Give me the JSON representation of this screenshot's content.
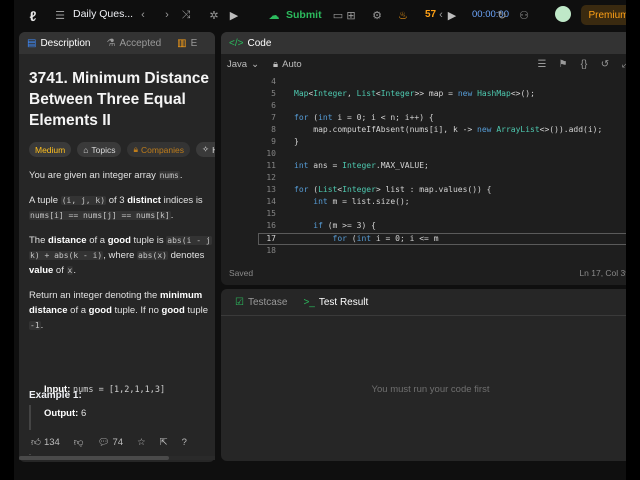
{
  "topnav": {
    "problem_list_label": "Daily Ques...",
    "submit_label": "Submit",
    "streak_count": "57",
    "timer": "00:00:00",
    "premium_label": "Premium"
  },
  "left": {
    "tabs": [
      {
        "label": "Description"
      },
      {
        "label": "Accepted"
      },
      {
        "label": "E"
      }
    ],
    "title": "3741. Minimum Distance\nBetween Three Equal\nElements II",
    "badges": {
      "difficulty": "Medium",
      "topics": "Topics",
      "companies": "Companies",
      "hint": "H"
    },
    "description": {
      "p1_a": "You are given an integer array ",
      "p1_code": "nums",
      "p1_b": ".",
      "p2_a": "A tuple ",
      "p2_code1": "(i, j, k)",
      "p2_b": " of 3 ",
      "p2_bold": "distinct",
      "p2_c": " indices is",
      "p2_code2": "nums[i] == nums[j] == nums[k]",
      "p2_d": ".",
      "p3_a": "The ",
      "p3_b1": "distance",
      "p3_c": " of a ",
      "p3_b2": "good",
      "p3_d": " tuple is ",
      "p3_code1": "abs(i - j",
      "p3_code2": "k) + abs(k - i)",
      "p3_e": ", where ",
      "p3_code3": "abs(x)",
      "p3_f": " denotes",
      "p3_b3": "value",
      "p3_g": " of ",
      "p3_code4": "x",
      "p3_h": ".",
      "p4_a": "Return an integer denoting the ",
      "p4_b1": "minimum",
      "p4_b2": "distance",
      "p4_c": " of a ",
      "p4_b3": "good",
      "p4_d": " tuple. If no ",
      "p4_b4": "good",
      "p4_e": " tuple",
      "p4_code": "-1",
      "p4_f": "."
    },
    "example": {
      "title": "Example 1:",
      "input_label": "Input:",
      "input_value": "nums = [1,2,1,1,3]",
      "output_label": "Output:",
      "output_value": "6"
    },
    "footer": {
      "likes": "134",
      "comments": "74"
    }
  },
  "code": {
    "tab_label": "Code",
    "language": "Java",
    "auto_label": "Auto",
    "status": "Saved",
    "cursor_pos": "Ln 17, Col 39",
    "lines": [
      {
        "n": "4",
        "text": ""
      },
      {
        "n": "5",
        "text": "Map<Integer, List<Integer>> map = new HashMap<>();"
      },
      {
        "n": "6",
        "text": ""
      },
      {
        "n": "7",
        "text": "for (int i = 0; i < n; i++) {"
      },
      {
        "n": "8",
        "text": "    map.computeIfAbsent(nums[i], k -> new ArrayList<>()).add(i);"
      },
      {
        "n": "9",
        "text": "}"
      },
      {
        "n": "10",
        "text": ""
      },
      {
        "n": "11",
        "text": "int ans = Integer.MAX_VALUE;"
      },
      {
        "n": "12",
        "text": ""
      },
      {
        "n": "13",
        "text": "for (List<Integer> list : map.values()) {"
      },
      {
        "n": "14",
        "text": "    int m = list.size();"
      },
      {
        "n": "15",
        "text": ""
      },
      {
        "n": "16",
        "text": "    if (m >= 3) {"
      },
      {
        "n": "17",
        "text": "        for (int i = 0; i <= m"
      },
      {
        "n": "18",
        "text": ""
      }
    ]
  },
  "result": {
    "tabs": [
      {
        "label": "Testcase"
      },
      {
        "label": "Test Result"
      }
    ],
    "message": "You must run your code first"
  }
}
